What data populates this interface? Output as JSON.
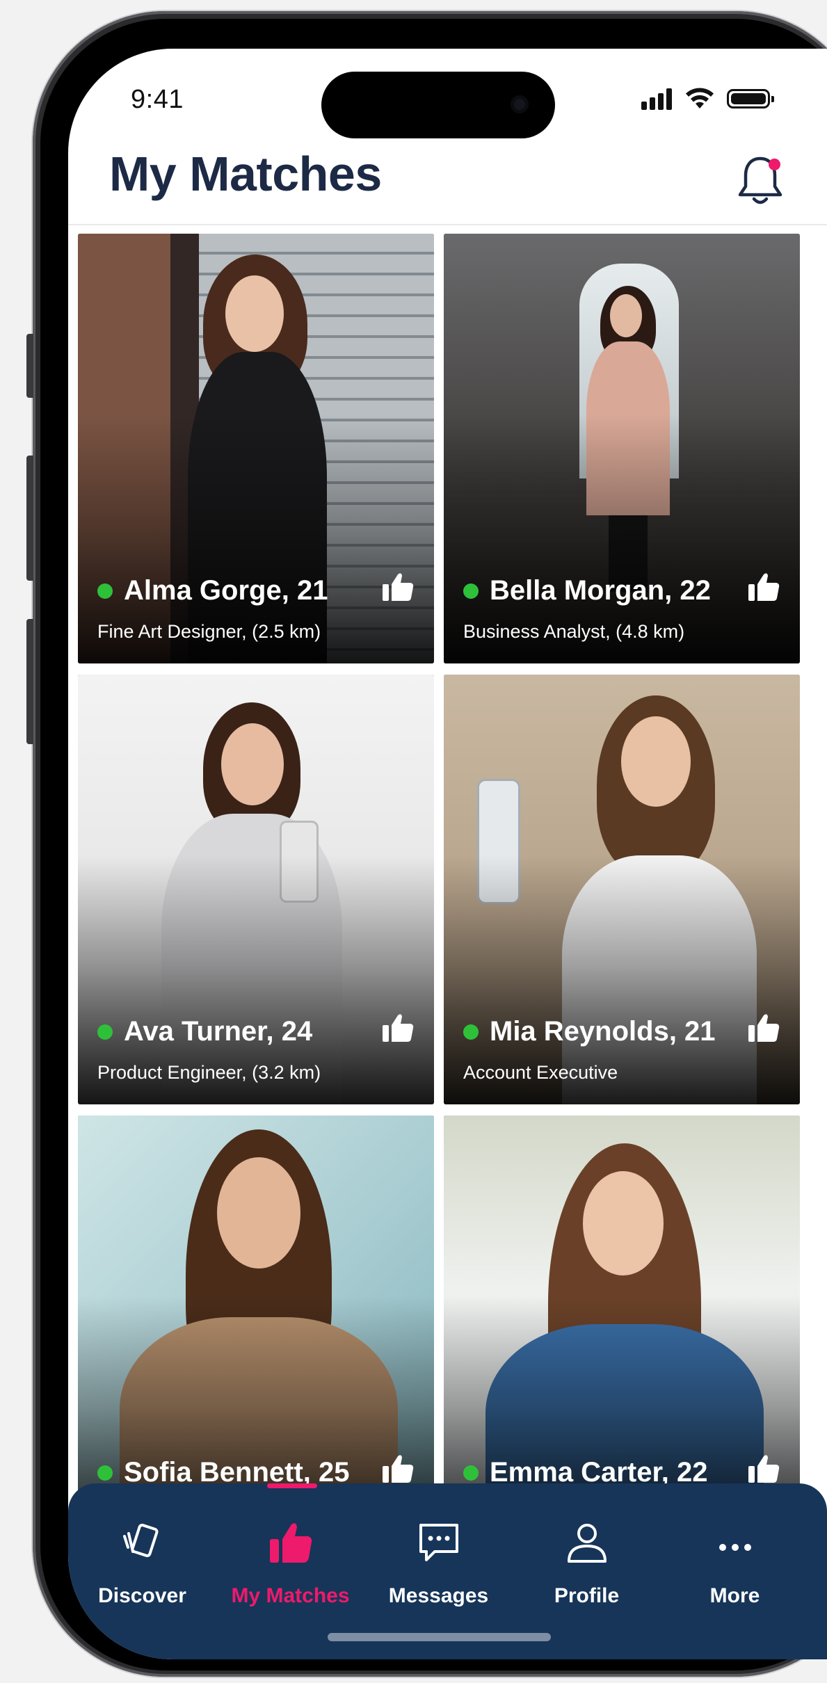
{
  "status_bar": {
    "time": "9:41"
  },
  "header": {
    "title": "My Matches"
  },
  "matches": [
    {
      "name": "Alma Gorge, 21",
      "subtitle": "Fine Art Designer, (2.5 km)"
    },
    {
      "name": "Bella Morgan, 22",
      "subtitle": "Business Analyst, (4.8 km)"
    },
    {
      "name": "Ava Turner, 24",
      "subtitle": "Product Engineer, (3.2 km)"
    },
    {
      "name": "Mia Reynolds, 21",
      "subtitle": "Account Executive"
    },
    {
      "name": "Sofia Bennett, 25",
      "subtitle": ""
    },
    {
      "name": "Emma Carter, 22",
      "subtitle": ""
    }
  ],
  "nav": {
    "items": [
      {
        "label": "Discover",
        "icon": "cards-icon"
      },
      {
        "label": "My Matches",
        "icon": "thumbs-up-icon"
      },
      {
        "label": "Messages",
        "icon": "chat-icon"
      },
      {
        "label": "Profile",
        "icon": "person-icon"
      },
      {
        "label": "More",
        "icon": "more-icon"
      }
    ],
    "active": "My Matches"
  },
  "colors": {
    "accent": "#ee1a6b",
    "nav_background": "#163559",
    "title": "#1d2a46",
    "online": "#2fc03a"
  }
}
